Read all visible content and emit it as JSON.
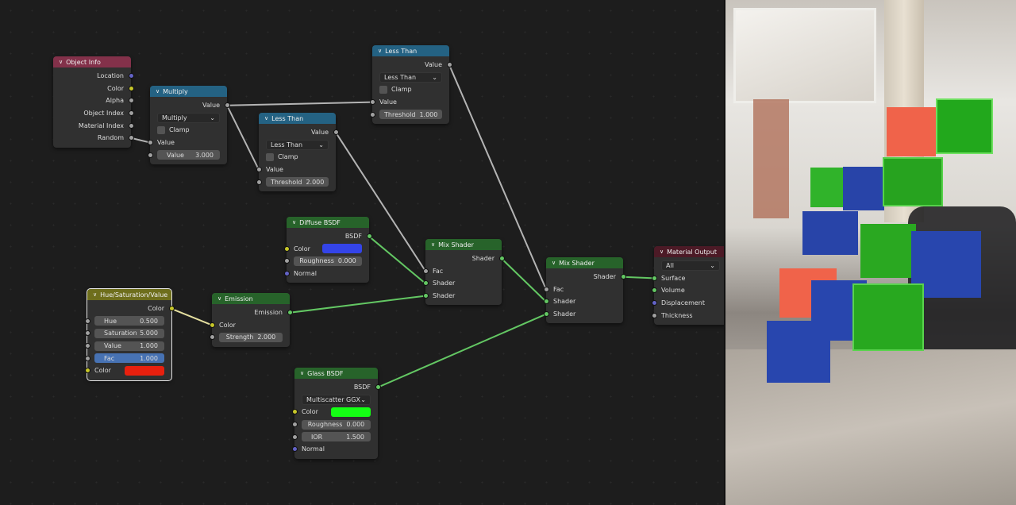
{
  "socket_colors": {
    "grey": "#a1a1a1",
    "yellow": "#c7c729",
    "purple": "#6363c7",
    "green": "#63c763"
  },
  "nodes": [
    {
      "id": "object-info",
      "title": "Object Info",
      "header_color": "#83314a",
      "rows": [
        {
          "t": "out",
          "label": "Location",
          "s": "purple"
        },
        {
          "t": "out",
          "label": "Color",
          "s": "yellow"
        },
        {
          "t": "out",
          "label": "Alpha",
          "s": "grey"
        },
        {
          "t": "out",
          "label": "Object Index",
          "s": "grey"
        },
        {
          "t": "out",
          "label": "Material Index",
          "s": "grey"
        },
        {
          "t": "out",
          "label": "Random",
          "s": "grey"
        }
      ]
    },
    {
      "id": "multiply",
      "title": "Multiply",
      "header_color": "#246283",
      "rows": [
        {
          "t": "out",
          "label": "Value",
          "s": "grey"
        },
        {
          "t": "dd",
          "label": "Multiply"
        },
        {
          "t": "cb",
          "label": "Clamp"
        },
        {
          "t": "in",
          "label": "Value",
          "s": "grey"
        },
        {
          "t": "fld",
          "label": "Value",
          "value": "3.000",
          "s": "grey"
        }
      ]
    },
    {
      "id": "less-than-1",
      "title": "Less Than",
      "header_color": "#246283",
      "rows": [
        {
          "t": "out",
          "label": "Value",
          "s": "grey"
        },
        {
          "t": "dd",
          "label": "Less Than"
        },
        {
          "t": "cb",
          "label": "Clamp"
        },
        {
          "t": "in",
          "label": "Value",
          "s": "grey"
        },
        {
          "t": "fldc",
          "label": "Threshold",
          "value": "2.000",
          "s": "grey"
        }
      ]
    },
    {
      "id": "less-than-2",
      "title": "Less Than",
      "header_color": "#246283",
      "rows": [
        {
          "t": "out",
          "label": "Value",
          "s": "grey"
        },
        {
          "t": "dd",
          "label": "Less Than"
        },
        {
          "t": "cb",
          "label": "Clamp"
        },
        {
          "t": "in",
          "label": "Value",
          "s": "grey"
        },
        {
          "t": "fldc",
          "label": "Threshold",
          "value": "1.000",
          "s": "grey"
        }
      ]
    },
    {
      "id": "diffuse-bsdf",
      "title": "Diffuse BSDF",
      "header_color": "#27632a",
      "rows": [
        {
          "t": "out",
          "label": "BSDF",
          "s": "green"
        },
        {
          "t": "color",
          "label": "Color",
          "swatch": "#3444e8",
          "s": "yellow"
        },
        {
          "t": "fldc",
          "label": "Roughness",
          "value": "0.000",
          "s": "grey"
        },
        {
          "t": "in",
          "label": "Normal",
          "s": "purple"
        }
      ]
    },
    {
      "id": "mix-shader-1",
      "title": "Mix Shader",
      "header_color": "#27632a",
      "rows": [
        {
          "t": "out",
          "label": "Shader",
          "s": "green"
        },
        {
          "t": "in",
          "label": "Fac",
          "s": "grey"
        },
        {
          "t": "in",
          "label": "Shader",
          "s": "green"
        },
        {
          "t": "in",
          "label": "Shader",
          "s": "green"
        }
      ]
    },
    {
      "id": "mix-shader-2",
      "title": "Mix Shader",
      "header_color": "#27632a",
      "rows": [
        {
          "t": "out",
          "label": "Shader",
          "s": "green"
        },
        {
          "t": "in",
          "label": "Fac",
          "s": "grey"
        },
        {
          "t": "in",
          "label": "Shader",
          "s": "green"
        },
        {
          "t": "in",
          "label": "Shader",
          "s": "green"
        }
      ]
    },
    {
      "id": "material-output",
      "title": "Material Output",
      "header_color": "#4c1a26",
      "rows": [
        {
          "t": "dd",
          "label": "All"
        },
        {
          "t": "in",
          "label": "Surface",
          "s": "green"
        },
        {
          "t": "in",
          "label": "Volume",
          "s": "green"
        },
        {
          "t": "in",
          "label": "Displacement",
          "s": "purple"
        },
        {
          "t": "in",
          "label": "Thickness",
          "s": "grey"
        }
      ]
    },
    {
      "id": "hue-saturation-value",
      "title": "Hue/Saturation/Value",
      "header_color": "#6e6e1c",
      "selected": true,
      "rows": [
        {
          "t": "out",
          "label": "Color",
          "s": "yellow"
        },
        {
          "t": "fld",
          "label": "Hue",
          "value": "0.500",
          "s": "grey"
        },
        {
          "t": "fld",
          "label": "Saturation",
          "value": "5.000",
          "s": "grey"
        },
        {
          "t": "fld",
          "label": "Value",
          "value": "1.000",
          "s": "grey"
        },
        {
          "t": "fldhl",
          "label": "Fac",
          "value": "1.000",
          "s": "grey"
        },
        {
          "t": "color",
          "label": "Color",
          "swatch": "#e8200e",
          "s": "yellow"
        }
      ]
    },
    {
      "id": "emission",
      "title": "Emission",
      "header_color": "#27632a",
      "rows": [
        {
          "t": "out",
          "label": "Emission",
          "s": "green"
        },
        {
          "t": "in",
          "label": "Color",
          "s": "yellow"
        },
        {
          "t": "fldc",
          "label": "Strength",
          "value": "2.000",
          "s": "grey"
        }
      ]
    },
    {
      "id": "glass-bsdf",
      "title": "Glass BSDF",
      "header_color": "#27632a",
      "rows": [
        {
          "t": "out",
          "label": "BSDF",
          "s": "green"
        },
        {
          "t": "dd",
          "label": "Multiscatter GGX"
        },
        {
          "t": "color",
          "label": "Color",
          "swatch": "#14ff14",
          "s": "yellow"
        },
        {
          "t": "fldc",
          "label": "Roughness",
          "value": "0.000",
          "s": "grey"
        },
        {
          "t": "fld",
          "label": "IOR",
          "value": "1.500",
          "s": "grey"
        },
        {
          "t": "in",
          "label": "Normal",
          "s": "purple"
        }
      ]
    }
  ],
  "links": [
    {
      "from": [
        "object-info",
        5
      ],
      "to": [
        "multiply",
        3
      ],
      "color": "#b4b4b4"
    },
    {
      "from": [
        "multiply",
        0
      ],
      "to": [
        "less-than-2",
        3
      ],
      "color": "#b4b4b4"
    },
    {
      "from": [
        "multiply",
        0
      ],
      "to": [
        "less-than-1",
        3
      ],
      "color": "#b4b4b4"
    },
    {
      "from": [
        "less-than-1",
        0
      ],
      "to": [
        "mix-shader-1",
        1
      ],
      "color": "#b4b4b4"
    },
    {
      "from": [
        "less-than-2",
        0
      ],
      "to": [
        "mix-shader-2",
        1
      ],
      "color": "#b4b4b4"
    },
    {
      "from": [
        "diffuse-bsdf",
        0
      ],
      "to": [
        "mix-shader-1",
        2
      ],
      "color": "#63c763"
    },
    {
      "from": [
        "emission",
        0
      ],
      "to": [
        "mix-shader-1",
        3
      ],
      "color": "#63c763"
    },
    {
      "from": [
        "mix-shader-1",
        0
      ],
      "to": [
        "mix-shader-2",
        2
      ],
      "color": "#63c763"
    },
    {
      "from": [
        "glass-bsdf",
        0
      ],
      "to": [
        "mix-shader-2",
        3
      ],
      "color": "#63c763"
    },
    {
      "from": [
        "mix-shader-2",
        0
      ],
      "to": [
        "material-output",
        1
      ],
      "color": "#63c763"
    },
    {
      "from": [
        "hue-saturation-value",
        0
      ],
      "to": [
        "emission",
        1
      ],
      "color": "#e6e0a0"
    }
  ]
}
